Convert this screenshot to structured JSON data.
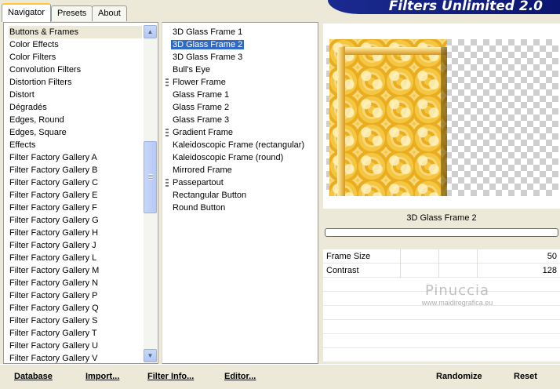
{
  "tabs": [
    {
      "label": "Navigator"
    },
    {
      "label": "Presets"
    },
    {
      "label": "About"
    }
  ],
  "app_title": "Filters Unlimited 2.0",
  "categories": [
    "Buttons & Frames",
    "Color Effects",
    "Color Filters",
    "Convolution Filters",
    "Distortion Filters",
    "Distort",
    "Dégradés",
    "Edges, Round",
    "Edges, Square",
    "Effects",
    "Filter Factory Gallery A",
    "Filter Factory Gallery B",
    "Filter Factory Gallery C",
    "Filter Factory Gallery E",
    "Filter Factory Gallery F",
    "Filter Factory Gallery G",
    "Filter Factory Gallery H",
    "Filter Factory Gallery J",
    "Filter Factory Gallery L",
    "Filter Factory Gallery M",
    "Filter Factory Gallery N",
    "Filter Factory Gallery P",
    "Filter Factory Gallery Q",
    "Filter Factory Gallery S",
    "Filter Factory Gallery T",
    "Filter Factory Gallery U",
    "Filter Factory Gallery V"
  ],
  "filters": [
    {
      "label": "3D Glass Frame 1",
      "grip": false
    },
    {
      "label": "3D Glass Frame 2",
      "grip": false
    },
    {
      "label": "3D Glass Frame 3",
      "grip": false
    },
    {
      "label": "Bull's Eye",
      "grip": false
    },
    {
      "label": "Flower Frame",
      "grip": true
    },
    {
      "label": "Glass Frame 1",
      "grip": false
    },
    {
      "label": "Glass Frame 2",
      "grip": false
    },
    {
      "label": "Glass Frame 3",
      "grip": false
    },
    {
      "label": "Gradient Frame",
      "grip": true
    },
    {
      "label": "Kaleidoscopic Frame (rectangular)",
      "grip": false
    },
    {
      "label": "Kaleidoscopic Frame (round)",
      "grip": false
    },
    {
      "label": "Mirrored Frame",
      "grip": false
    },
    {
      "label": "Passepartout",
      "grip": true
    },
    {
      "label": "Rectangular Button",
      "grip": false
    },
    {
      "label": "Round Button",
      "grip": false
    }
  ],
  "selected_category": "Buttons & Frames",
  "selected_filter": "3D Glass Frame 2",
  "effect_name": "3D Glass Frame 2",
  "params": [
    {
      "label": "Frame Size",
      "value": "50"
    },
    {
      "label": "Contrast",
      "value": "128"
    }
  ],
  "watermark": {
    "main": "Pinuccia",
    "sub": "www.maidiregrafica.eu"
  },
  "buttons": {
    "database": "Database",
    "import": "Import...",
    "filter_info": "Filter Info...",
    "editor": "Editor...",
    "randomize": "Randomize",
    "reset": "Reset"
  }
}
